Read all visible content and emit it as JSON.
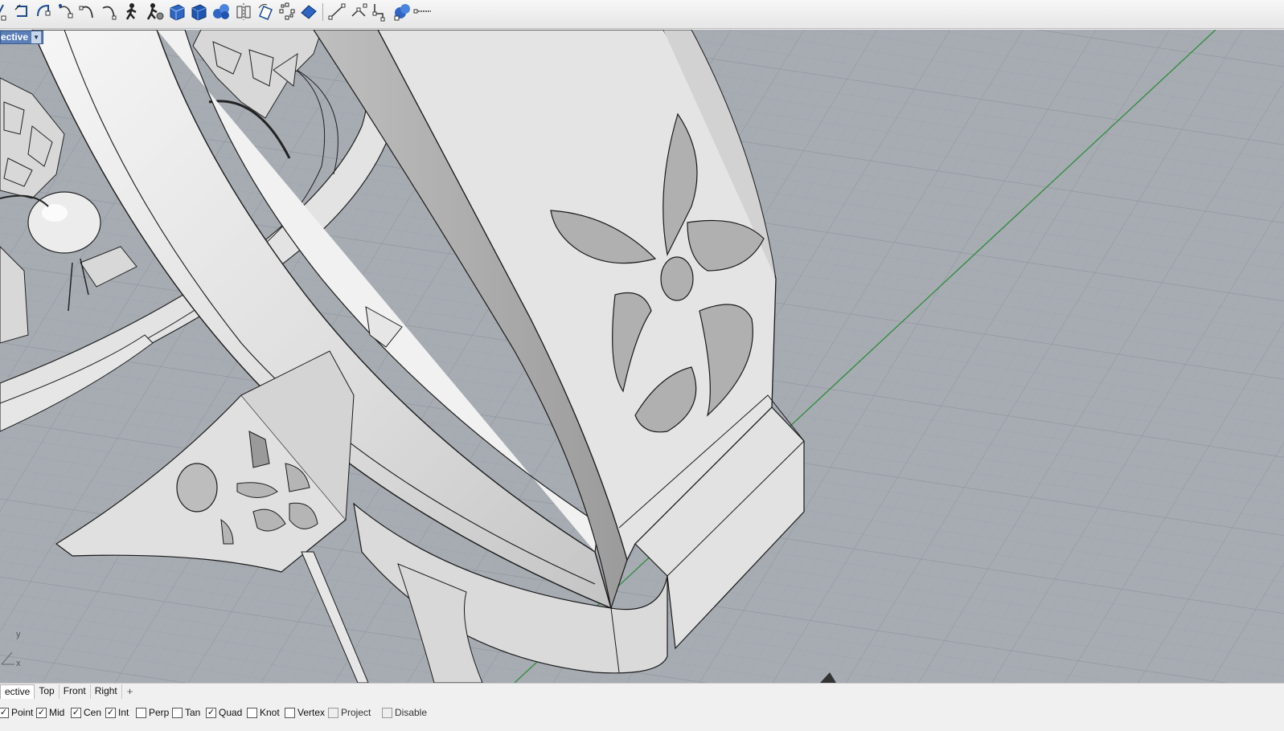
{
  "toolbar": {
    "icons": [
      "curve-tool-icon",
      "undo-icon",
      "redo-icon",
      "curve-from-point-icon",
      "arc-icon",
      "arc-3pt-icon",
      "walk-icon",
      "walk-gear-icon",
      "box-icon",
      "solid-box-icon",
      "sphere-group-icon",
      "mirror-icon",
      "rotate-icon",
      "move-icon",
      "points-on-icon",
      "gumball-icon",
      "polyline-icon",
      "split-icon",
      "trim-icon",
      "boolean-icon",
      "line-icon"
    ]
  },
  "viewport": {
    "title": "ective",
    "axis_y": "y",
    "axis_x": "x"
  },
  "tabs": [
    {
      "label": "ective",
      "active": true
    },
    {
      "label": "Top",
      "active": false
    },
    {
      "label": "Front",
      "active": false
    },
    {
      "label": "Right",
      "active": false
    },
    {
      "label": "+",
      "active": false
    }
  ],
  "osnaps": [
    {
      "label": "Point",
      "checked": true
    },
    {
      "label": "Mid",
      "checked": true
    },
    {
      "label": "Cen",
      "checked": true
    },
    {
      "label": "Int",
      "checked": true
    },
    {
      "label": "Perp",
      "checked": false
    },
    {
      "label": "Tan",
      "checked": false
    },
    {
      "label": "Quad",
      "checked": true
    },
    {
      "label": "Knot",
      "checked": false
    },
    {
      "label": "Vertex",
      "checked": false
    },
    {
      "label": "Project",
      "checked": false,
      "dim": true
    },
    {
      "label": "Disable",
      "checked": false,
      "dim": true
    }
  ],
  "colors": {
    "viewport_bg": "#a7acb3",
    "grid_line": "#9a9fa7",
    "axis_green": "#2e8b3a",
    "model_fill": "#e6e6e6",
    "title_bar": "#5a7fb6"
  }
}
